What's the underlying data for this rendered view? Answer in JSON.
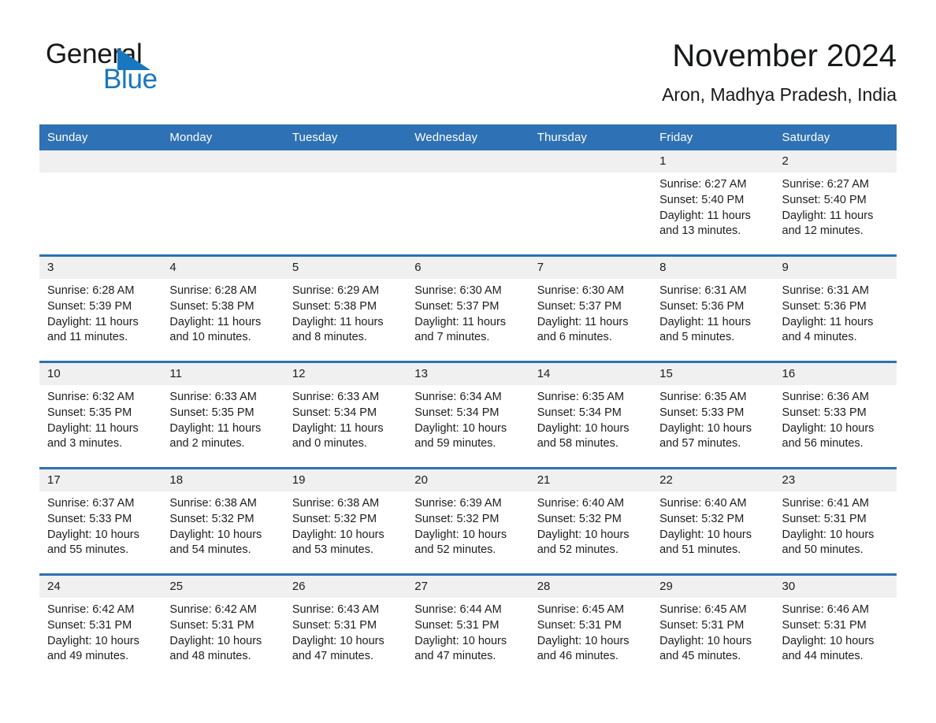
{
  "brand": {
    "name_part1": "General",
    "name_part2": "Blue",
    "accent_color": "#1877bf"
  },
  "header": {
    "month_title": "November 2024",
    "location": "Aron, Madhya Pradesh, India"
  },
  "colors": {
    "header_blue": "#2e71b4",
    "daynum_band": "#f0f0f0",
    "text": "#1b1d1f"
  },
  "weekday_headers": [
    "Sunday",
    "Monday",
    "Tuesday",
    "Wednesday",
    "Thursday",
    "Friday",
    "Saturday"
  ],
  "weeks": [
    [
      {
        "day": "",
        "sunrise": "",
        "sunset": "",
        "daylight1": "",
        "daylight2": ""
      },
      {
        "day": "",
        "sunrise": "",
        "sunset": "",
        "daylight1": "",
        "daylight2": ""
      },
      {
        "day": "",
        "sunrise": "",
        "sunset": "",
        "daylight1": "",
        "daylight2": ""
      },
      {
        "day": "",
        "sunrise": "",
        "sunset": "",
        "daylight1": "",
        "daylight2": ""
      },
      {
        "day": "",
        "sunrise": "",
        "sunset": "",
        "daylight1": "",
        "daylight2": ""
      },
      {
        "day": "1",
        "sunrise": "Sunrise: 6:27 AM",
        "sunset": "Sunset: 5:40 PM",
        "daylight1": "Daylight: 11 hours",
        "daylight2": "and 13 minutes."
      },
      {
        "day": "2",
        "sunrise": "Sunrise: 6:27 AM",
        "sunset": "Sunset: 5:40 PM",
        "daylight1": "Daylight: 11 hours",
        "daylight2": "and 12 minutes."
      }
    ],
    [
      {
        "day": "3",
        "sunrise": "Sunrise: 6:28 AM",
        "sunset": "Sunset: 5:39 PM",
        "daylight1": "Daylight: 11 hours",
        "daylight2": "and 11 minutes."
      },
      {
        "day": "4",
        "sunrise": "Sunrise: 6:28 AM",
        "sunset": "Sunset: 5:38 PM",
        "daylight1": "Daylight: 11 hours",
        "daylight2": "and 10 minutes."
      },
      {
        "day": "5",
        "sunrise": "Sunrise: 6:29 AM",
        "sunset": "Sunset: 5:38 PM",
        "daylight1": "Daylight: 11 hours",
        "daylight2": "and 8 minutes."
      },
      {
        "day": "6",
        "sunrise": "Sunrise: 6:30 AM",
        "sunset": "Sunset: 5:37 PM",
        "daylight1": "Daylight: 11 hours",
        "daylight2": "and 7 minutes."
      },
      {
        "day": "7",
        "sunrise": "Sunrise: 6:30 AM",
        "sunset": "Sunset: 5:37 PM",
        "daylight1": "Daylight: 11 hours",
        "daylight2": "and 6 minutes."
      },
      {
        "day": "8",
        "sunrise": "Sunrise: 6:31 AM",
        "sunset": "Sunset: 5:36 PM",
        "daylight1": "Daylight: 11 hours",
        "daylight2": "and 5 minutes."
      },
      {
        "day": "9",
        "sunrise": "Sunrise: 6:31 AM",
        "sunset": "Sunset: 5:36 PM",
        "daylight1": "Daylight: 11 hours",
        "daylight2": "and 4 minutes."
      }
    ],
    [
      {
        "day": "10",
        "sunrise": "Sunrise: 6:32 AM",
        "sunset": "Sunset: 5:35 PM",
        "daylight1": "Daylight: 11 hours",
        "daylight2": "and 3 minutes."
      },
      {
        "day": "11",
        "sunrise": "Sunrise: 6:33 AM",
        "sunset": "Sunset: 5:35 PM",
        "daylight1": "Daylight: 11 hours",
        "daylight2": "and 2 minutes."
      },
      {
        "day": "12",
        "sunrise": "Sunrise: 6:33 AM",
        "sunset": "Sunset: 5:34 PM",
        "daylight1": "Daylight: 11 hours",
        "daylight2": "and 0 minutes."
      },
      {
        "day": "13",
        "sunrise": "Sunrise: 6:34 AM",
        "sunset": "Sunset: 5:34 PM",
        "daylight1": "Daylight: 10 hours",
        "daylight2": "and 59 minutes."
      },
      {
        "day": "14",
        "sunrise": "Sunrise: 6:35 AM",
        "sunset": "Sunset: 5:34 PM",
        "daylight1": "Daylight: 10 hours",
        "daylight2": "and 58 minutes."
      },
      {
        "day": "15",
        "sunrise": "Sunrise: 6:35 AM",
        "sunset": "Sunset: 5:33 PM",
        "daylight1": "Daylight: 10 hours",
        "daylight2": "and 57 minutes."
      },
      {
        "day": "16",
        "sunrise": "Sunrise: 6:36 AM",
        "sunset": "Sunset: 5:33 PM",
        "daylight1": "Daylight: 10 hours",
        "daylight2": "and 56 minutes."
      }
    ],
    [
      {
        "day": "17",
        "sunrise": "Sunrise: 6:37 AM",
        "sunset": "Sunset: 5:33 PM",
        "daylight1": "Daylight: 10 hours",
        "daylight2": "and 55 minutes."
      },
      {
        "day": "18",
        "sunrise": "Sunrise: 6:38 AM",
        "sunset": "Sunset: 5:32 PM",
        "daylight1": "Daylight: 10 hours",
        "daylight2": "and 54 minutes."
      },
      {
        "day": "19",
        "sunrise": "Sunrise: 6:38 AM",
        "sunset": "Sunset: 5:32 PM",
        "daylight1": "Daylight: 10 hours",
        "daylight2": "and 53 minutes."
      },
      {
        "day": "20",
        "sunrise": "Sunrise: 6:39 AM",
        "sunset": "Sunset: 5:32 PM",
        "daylight1": "Daylight: 10 hours",
        "daylight2": "and 52 minutes."
      },
      {
        "day": "21",
        "sunrise": "Sunrise: 6:40 AM",
        "sunset": "Sunset: 5:32 PM",
        "daylight1": "Daylight: 10 hours",
        "daylight2": "and 52 minutes."
      },
      {
        "day": "22",
        "sunrise": "Sunrise: 6:40 AM",
        "sunset": "Sunset: 5:32 PM",
        "daylight1": "Daylight: 10 hours",
        "daylight2": "and 51 minutes."
      },
      {
        "day": "23",
        "sunrise": "Sunrise: 6:41 AM",
        "sunset": "Sunset: 5:31 PM",
        "daylight1": "Daylight: 10 hours",
        "daylight2": "and 50 minutes."
      }
    ],
    [
      {
        "day": "24",
        "sunrise": "Sunrise: 6:42 AM",
        "sunset": "Sunset: 5:31 PM",
        "daylight1": "Daylight: 10 hours",
        "daylight2": "and 49 minutes."
      },
      {
        "day": "25",
        "sunrise": "Sunrise: 6:42 AM",
        "sunset": "Sunset: 5:31 PM",
        "daylight1": "Daylight: 10 hours",
        "daylight2": "and 48 minutes."
      },
      {
        "day": "26",
        "sunrise": "Sunrise: 6:43 AM",
        "sunset": "Sunset: 5:31 PM",
        "daylight1": "Daylight: 10 hours",
        "daylight2": "and 47 minutes."
      },
      {
        "day": "27",
        "sunrise": "Sunrise: 6:44 AM",
        "sunset": "Sunset: 5:31 PM",
        "daylight1": "Daylight: 10 hours",
        "daylight2": "and 47 minutes."
      },
      {
        "day": "28",
        "sunrise": "Sunrise: 6:45 AM",
        "sunset": "Sunset: 5:31 PM",
        "daylight1": "Daylight: 10 hours",
        "daylight2": "and 46 minutes."
      },
      {
        "day": "29",
        "sunrise": "Sunrise: 6:45 AM",
        "sunset": "Sunset: 5:31 PM",
        "daylight1": "Daylight: 10 hours",
        "daylight2": "and 45 minutes."
      },
      {
        "day": "30",
        "sunrise": "Sunrise: 6:46 AM",
        "sunset": "Sunset: 5:31 PM",
        "daylight1": "Daylight: 10 hours",
        "daylight2": "and 44 minutes."
      }
    ]
  ]
}
